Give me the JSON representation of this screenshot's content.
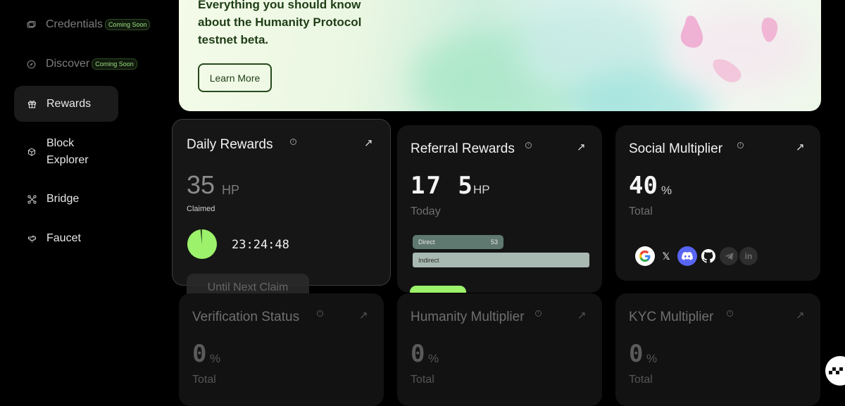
{
  "sidebar": {
    "items": [
      {
        "label": "Credentials",
        "badge": "Coming Soon",
        "icon": "credential-icon"
      },
      {
        "label": "Discover",
        "badge": "Coming Soon",
        "icon": "compass-icon"
      },
      {
        "label": "Rewards",
        "icon": "gift-icon"
      },
      {
        "label": "Block Explorer",
        "icon": "cube-icon"
      },
      {
        "label": "Bridge",
        "icon": "bridge-icon"
      },
      {
        "label": "Faucet",
        "icon": "faucet-icon"
      }
    ]
  },
  "hero": {
    "title": "Everything you should know about the Humanity Protocol testnet beta.",
    "button": "Learn More"
  },
  "daily": {
    "title": "Daily Rewards",
    "value": "35",
    "unit": "HP",
    "status": "Claimed",
    "timer": "23:24:48",
    "next_claim": "Until Next Claim",
    "progress": 0.98
  },
  "referral": {
    "title": "Referral Rewards",
    "value": "17 5",
    "unit": "HP",
    "period": "Today",
    "bars": [
      {
        "label": "Direct",
        "value": "53"
      },
      {
        "label": "Indirect",
        "value": ""
      }
    ]
  },
  "social": {
    "title": "Social Multiplier",
    "value": "40",
    "unit": "%",
    "period": "Total",
    "icons": [
      "google-icon",
      "x-icon",
      "discord-icon",
      "github-icon",
      "telegram-icon",
      "linkedin-icon"
    ],
    "linkedin_text": "in"
  },
  "verification": {
    "title": "Verification Status",
    "value": "0",
    "unit": "%",
    "period": "Total"
  },
  "humanity": {
    "title": "Humanity Multiplier",
    "value": "0",
    "unit": "%",
    "period": "Total"
  },
  "kyc": {
    "title": "KYC Multiplier",
    "value": "0",
    "unit": "%",
    "period": "Total"
  },
  "colors": {
    "accent": "#9cf26b",
    "card": "#141414",
    "background": "#000000"
  }
}
